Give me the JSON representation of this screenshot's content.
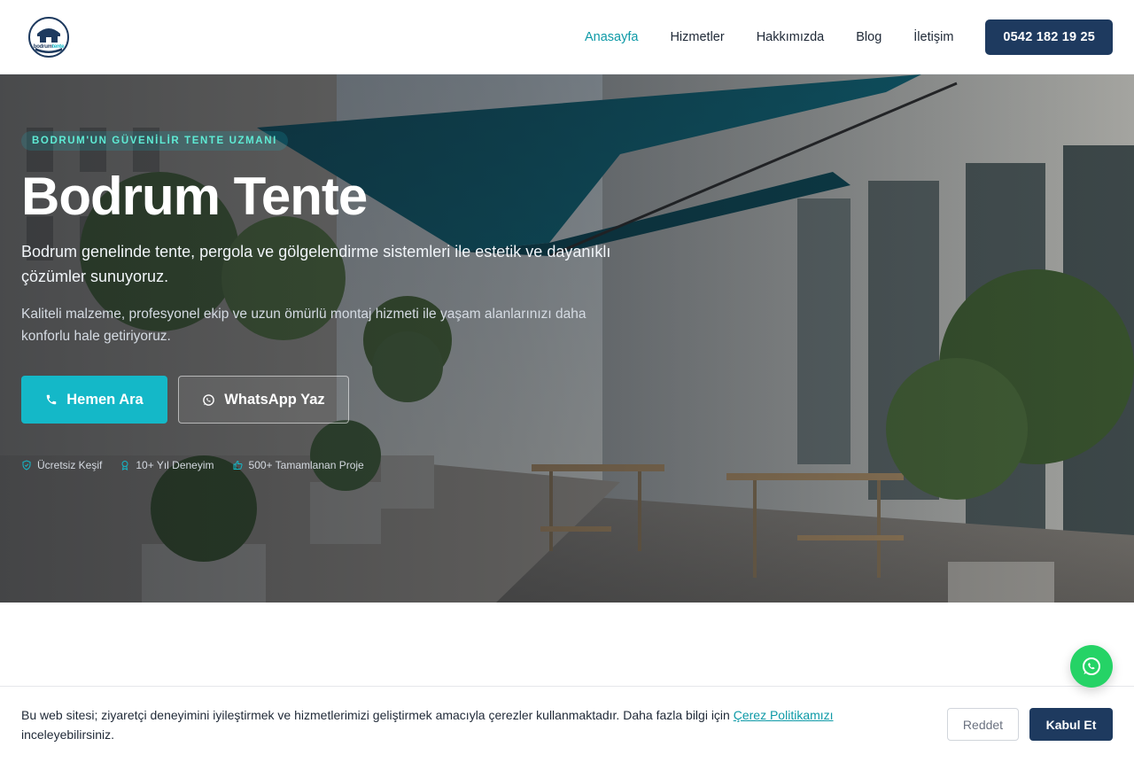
{
  "header": {
    "logo": {
      "brand_part1": "bodrum",
      "brand_part2": "tente"
    },
    "nav": [
      {
        "label": "Anasayfa",
        "active": true
      },
      {
        "label": "Hizmetler",
        "active": false
      },
      {
        "label": "Hakkımızda",
        "active": false
      },
      {
        "label": "Blog",
        "active": false
      },
      {
        "label": "İletişim",
        "active": false
      }
    ],
    "phone_button": "0542 182 19 25"
  },
  "hero": {
    "badge": "BODRUM'UN GÜVENİLİR TENTE UZMANI",
    "title": "Bodrum Tente",
    "subtitle": "Bodrum genelinde tente, pergola ve gölgelendirme sistemleri ile estetik ve dayanıklı çözümler sunuyoruz.",
    "description": "Kaliteli malzeme, profesyonel ekip ve uzun ömürlü montaj hizmeti ile yaşam alanlarınızı daha konforlu hale getiriyoruz.",
    "primary_button": "Hemen Ara",
    "secondary_button": "WhatsApp Yaz",
    "features": [
      {
        "icon": "shield-check-icon",
        "label": "Ücretsiz Keşif"
      },
      {
        "icon": "award-icon",
        "label": "10+ Yıl Deneyim"
      },
      {
        "icon": "thumbs-up-icon",
        "label": "500+ Tamamlanan Proje"
      }
    ]
  },
  "cookie": {
    "text": "Bu web sitesi; ziyaretçi deneyimini iyileştirmek ve hizmetlerimizi geliştirmek amacıyla çerezler kullanmaktadır. Daha fazla bilgi için ",
    "link": "Çerez Politikamızı",
    "text_after": " inceleyebilirsiniz.",
    "reject_button": "Reddet",
    "accept_button": "Kabul Et"
  },
  "colors": {
    "brand_navy": "#1e3a5f",
    "accent_teal": "#14b8c8",
    "active_nav": "#0e9aa7",
    "whatsapp_green": "#25d366"
  }
}
